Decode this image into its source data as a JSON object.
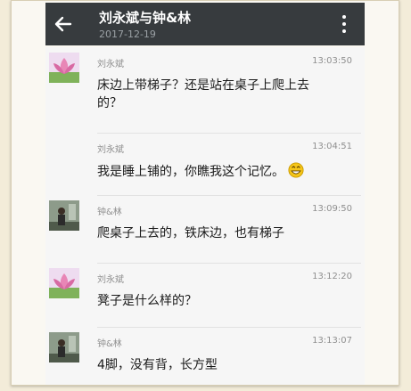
{
  "header": {
    "title": "刘永斌与钟&林",
    "date": "2017-12-19",
    "back_icon": "arrow-left-icon",
    "menu_icon": "more-vertical-icon"
  },
  "messages": [
    {
      "sender": "刘永斌",
      "time": "13:03:50",
      "text": "床边上带梯子？还是站在桌子上爬上去的？",
      "avatar": "lotus-avatar"
    },
    {
      "sender": "刘永斌",
      "time": "13:04:51",
      "text": "我是睡上铺的，你瞧我这个记忆。",
      "emoji": "grinning-emoji-icon"
    },
    {
      "sender": "钟&林",
      "time": "13:09:50",
      "text": "爬桌子上去的，铁床边，也有梯子",
      "avatar": "photo-avatar"
    },
    {
      "sender": "刘永斌",
      "time": "13:12:20",
      "text": "凳子是什么样的？",
      "avatar": "lotus-avatar"
    },
    {
      "sender": "钟&林",
      "time": "13:13:07",
      "text": "4脚，没有背，长方型",
      "avatar": "photo-avatar"
    }
  ]
}
